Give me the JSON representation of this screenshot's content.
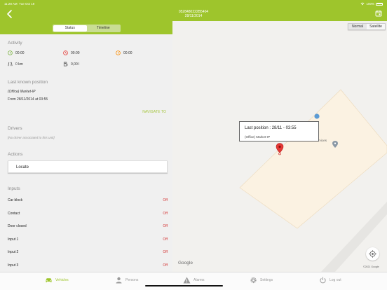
{
  "statusbar": {
    "time": "11:28 AM",
    "date": "Tue Oct 19",
    "battery": "100%"
  },
  "header": {
    "title": "0528480222B5404",
    "subtitle": "28/11/2014"
  },
  "tabs": {
    "status": "Status",
    "timeline": "Timeline",
    "selected": "Status"
  },
  "activity": {
    "title": "Activity",
    "driving_time": "00:00",
    "idle_time": "00:00",
    "stop_time": "00:00",
    "distance": "0 km",
    "fuel": "0,00 l"
  },
  "last_position": {
    "title": "Last known position",
    "place": "(Office) Market-IP",
    "since": "From 28/11/2014 at 03:55",
    "navigate_label": "NAVIGATE TO"
  },
  "drivers": {
    "title": "Drivers",
    "empty": "[No driver associated to this unit]"
  },
  "actions": {
    "title": "Actions",
    "locate": "Locate"
  },
  "inputs": {
    "title": "Inputs",
    "rows": [
      {
        "label": "Car block",
        "state": "Off"
      },
      {
        "label": "Contact",
        "state": "Off"
      },
      {
        "label": "Door closed",
        "state": "Off"
      },
      {
        "label": "Input 1",
        "state": "Off"
      },
      {
        "label": "Input 2",
        "state": "Off"
      },
      {
        "label": "Input 3",
        "state": "Off"
      }
    ]
  },
  "map": {
    "type_normal": "Normal",
    "type_satellite": "Satellite",
    "selected_type": "Normal",
    "info_title": "Last position : 28/11 - 03:55",
    "info_place": "(Office) Market-IP",
    "poi_label": "rvices",
    "logo": "Google",
    "copyright": "©2021 Google"
  },
  "tabbar": {
    "vehicles": "Vehicles",
    "persons": "Persons",
    "alarms": "Alarms",
    "settings": "Settings",
    "logout": "Log out",
    "active": "Vehicles"
  },
  "colors": {
    "brand": "#9ec52c",
    "off_state": "#d32f2f",
    "marker": "#e53935",
    "poi": "#5b9bd5"
  },
  "icons": [
    "back-icon",
    "calendar-icon",
    "wifi-icon",
    "battery-icon",
    "clock-green-icon",
    "clock-red-icon",
    "clock-orange-icon",
    "road-icon",
    "fuel-icon",
    "map-marker-icon",
    "my-location-icon",
    "car-icon",
    "person-icon",
    "alarm-icon",
    "settings-icon",
    "power-icon"
  ]
}
